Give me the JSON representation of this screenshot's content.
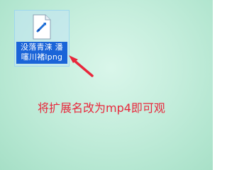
{
  "desktop": {
    "file": {
      "label": "没落青涞 潘\n噻川褚lpng",
      "icon": "image-file-icon"
    },
    "instruction": "将扩展名改为mp4即可观",
    "colors": {
      "instruction_text": "#e8273b",
      "arrow": "#e8273b",
      "selection_label_bg": "#1a64d8",
      "background": "#c6eedd"
    }
  }
}
